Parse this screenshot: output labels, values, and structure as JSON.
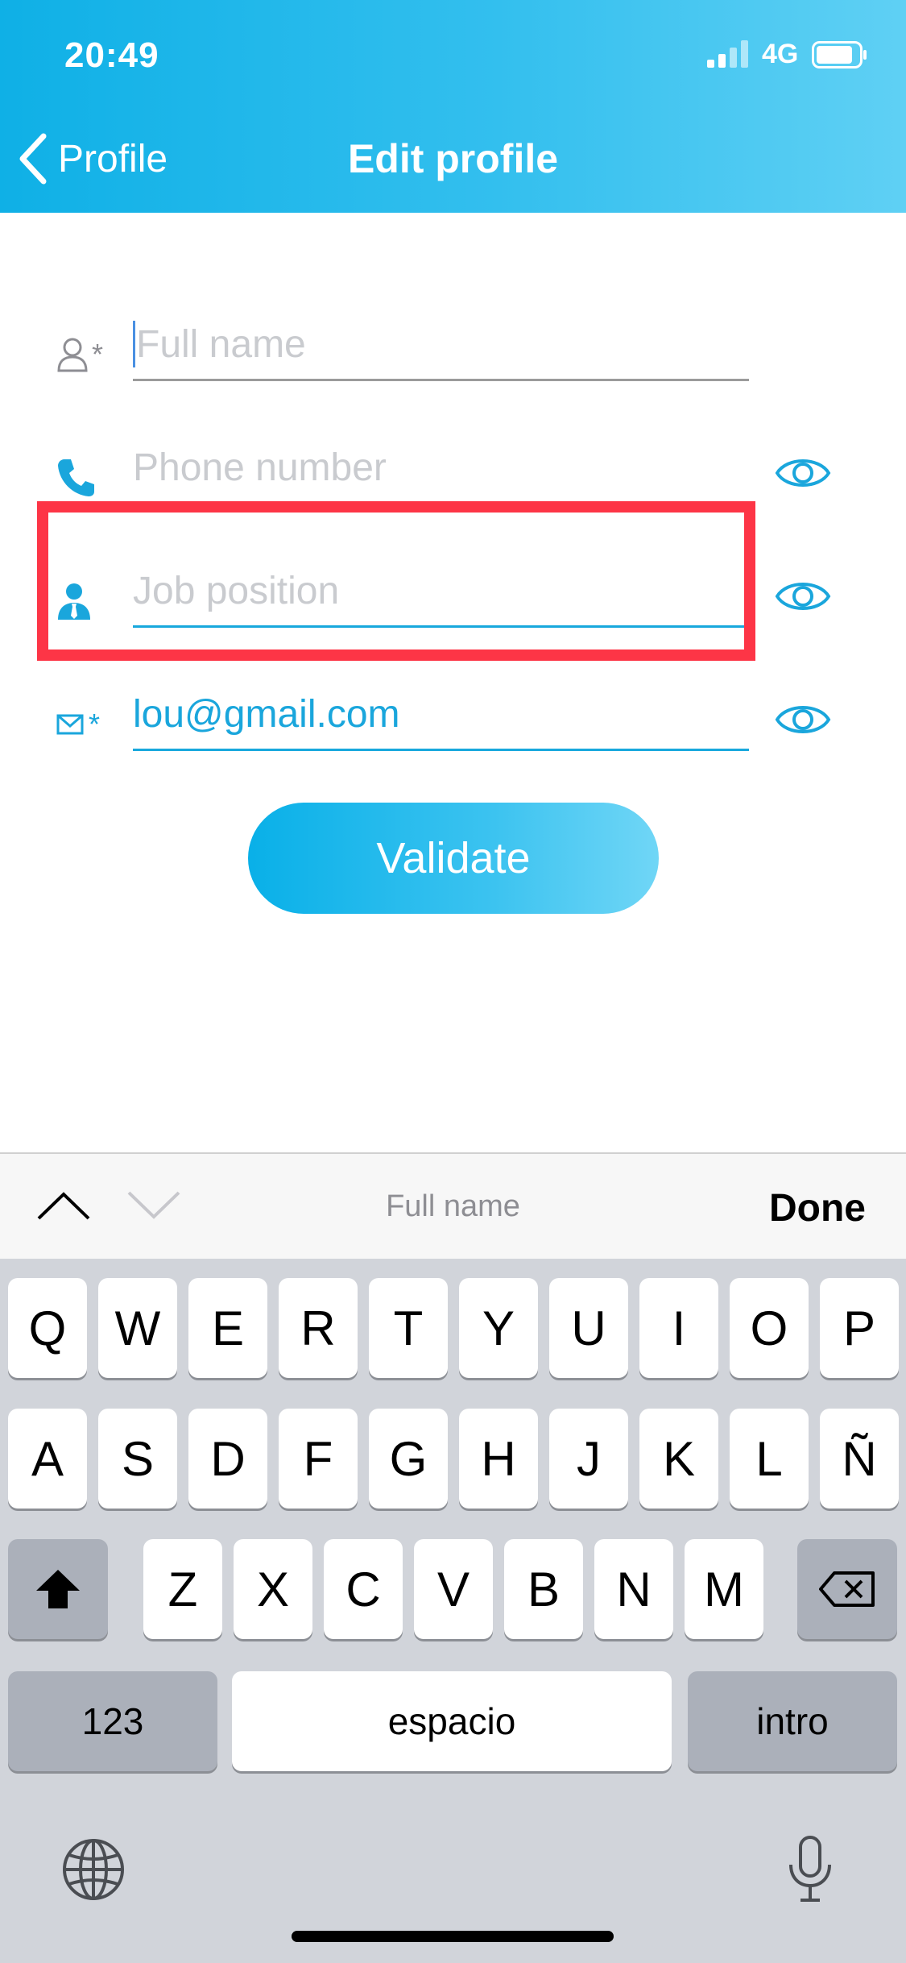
{
  "status": {
    "time": "20:49",
    "network": "4G"
  },
  "nav": {
    "back_label": "Profile",
    "title": "Edit profile"
  },
  "form": {
    "full_name": {
      "value": "",
      "placeholder": "Full name"
    },
    "phone": {
      "value": "",
      "placeholder": "Phone number"
    },
    "job": {
      "value": "",
      "placeholder": "Job position"
    },
    "email": {
      "value": "lou@gmail.com",
      "placeholder": ""
    },
    "required_mark": "*"
  },
  "validate_label": "Validate",
  "accessory": {
    "field_label": "Full name",
    "done_label": "Done"
  },
  "keyboard": {
    "row1": [
      "Q",
      "W",
      "E",
      "R",
      "T",
      "Y",
      "U",
      "I",
      "O",
      "P"
    ],
    "row2": [
      "A",
      "S",
      "D",
      "F",
      "G",
      "H",
      "J",
      "K",
      "L",
      "Ñ"
    ],
    "row3": [
      "Z",
      "X",
      "C",
      "V",
      "B",
      "N",
      "M"
    ],
    "numbers_label": "123",
    "space_label": "espacio",
    "return_label": "intro"
  },
  "colors": {
    "accent": "#1aa6dc",
    "highlight": "#fd3546",
    "header_start": "#0fb0e6",
    "header_end": "#5fd0f4"
  }
}
